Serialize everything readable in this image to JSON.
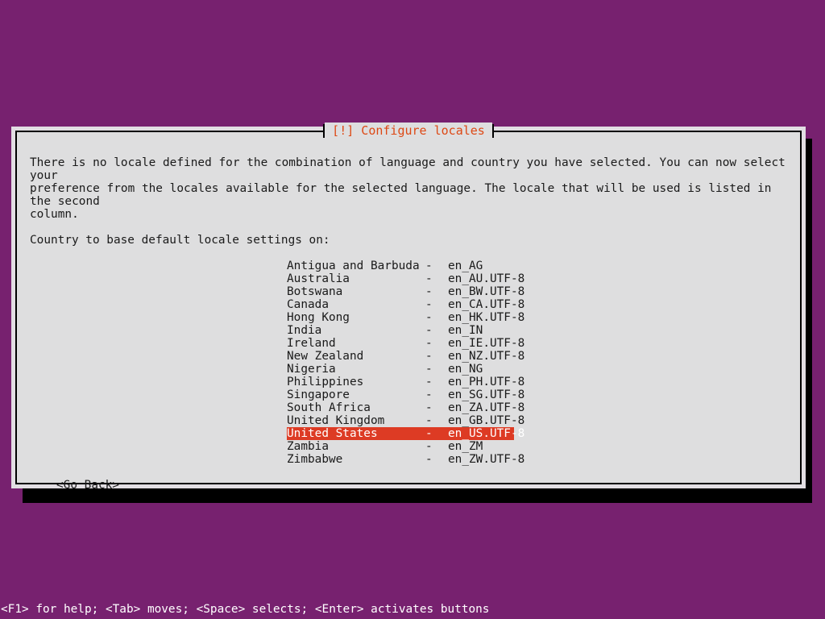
{
  "screen": {
    "background_color": "#77216F",
    "dialog_background": "#DEDEDF",
    "dialog_margin_color": "#E2DEE3",
    "accent_color": "#DD4814",
    "highlight_color": "#DD3B24",
    "text_color": "#1A1A1A"
  },
  "dialog": {
    "title": "[!] Configure locales",
    "intro_text": "There is no locale defined for the combination of language and country you have selected. You can now select your\npreference from the locales available for the selected language. The locale that will be used is listed in the second\ncolumn.",
    "prompt": "Country to base default locale settings on:",
    "separator": "-",
    "locales": [
      {
        "country": "Antigua and Barbuda",
        "code": "en_AG",
        "selected": false
      },
      {
        "country": "Australia",
        "code": "en_AU.UTF-8",
        "selected": false
      },
      {
        "country": "Botswana",
        "code": "en_BW.UTF-8",
        "selected": false
      },
      {
        "country": "Canada",
        "code": "en_CA.UTF-8",
        "selected": false
      },
      {
        "country": "Hong Kong",
        "code": "en_HK.UTF-8",
        "selected": false
      },
      {
        "country": "India",
        "code": "en_IN",
        "selected": false
      },
      {
        "country": "Ireland",
        "code": "en_IE.UTF-8",
        "selected": false
      },
      {
        "country": "New Zealand",
        "code": "en_NZ.UTF-8",
        "selected": false
      },
      {
        "country": "Nigeria",
        "code": "en_NG",
        "selected": false
      },
      {
        "country": "Philippines",
        "code": "en_PH.UTF-8",
        "selected": false
      },
      {
        "country": "Singapore",
        "code": "en_SG.UTF-8",
        "selected": false
      },
      {
        "country": "South Africa",
        "code": "en_ZA.UTF-8",
        "selected": false
      },
      {
        "country": "United Kingdom",
        "code": "en_GB.UTF-8",
        "selected": false
      },
      {
        "country": "United States",
        "code": "en_US.UTF-8",
        "selected": true
      },
      {
        "country": "Zambia",
        "code": "en_ZM",
        "selected": false
      },
      {
        "country": "Zimbabwe",
        "code": "en_ZW.UTF-8",
        "selected": false
      }
    ],
    "go_back_button": "<Go Back>"
  },
  "footer": {
    "help_text": "<F1> for help; <Tab> moves; <Space> selects; <Enter> activates buttons"
  }
}
